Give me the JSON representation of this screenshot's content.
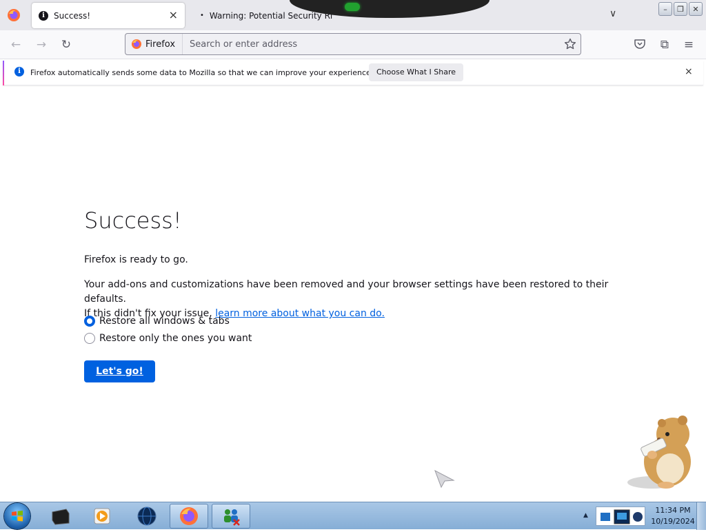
{
  "tabs": {
    "active": {
      "title": "Success!",
      "icon": "info-icon",
      "close": "×"
    },
    "inactive": {
      "title": "Warning: Potential Security Ri",
      "bullet": "•"
    },
    "list_chevron": "∨"
  },
  "window_controls": {
    "minimize": "–",
    "restore": "❐",
    "close": "✕"
  },
  "navbar": {
    "back": "←",
    "forward": "→",
    "reload": "↻",
    "identity_label": "Firefox",
    "url_value": "",
    "url_placeholder": "Search or enter address",
    "extensions": "⧉",
    "menu": "≡"
  },
  "notification": {
    "message": "Firefox automatically sends some data to Mozilla so that we can improve your experience.",
    "button": "Choose What I Share",
    "close": "×"
  },
  "page": {
    "title": "Success!",
    "ready": "Firefox is ready to go.",
    "body_line1": "Your add-ons and customizations have been removed and your browser settings have been restored to their defaults.",
    "body_line2_prefix": "If this didn't fix your issue, ",
    "learn_more_link": "learn more about what you can do.",
    "options": [
      {
        "label": "Restore all windows & tabs",
        "selected": true
      },
      {
        "label": "Restore only the ones you want",
        "selected": false
      }
    ],
    "go_button": "Let's go!"
  },
  "taskbar": {
    "clock_time": "11:34 PM",
    "clock_date": "10/19/2024",
    "tray_expand": "▲"
  },
  "colors": {
    "accent": "#0061e0",
    "tab_strip": "#e8e8ed",
    "taskbar": "#a9c7e6"
  }
}
